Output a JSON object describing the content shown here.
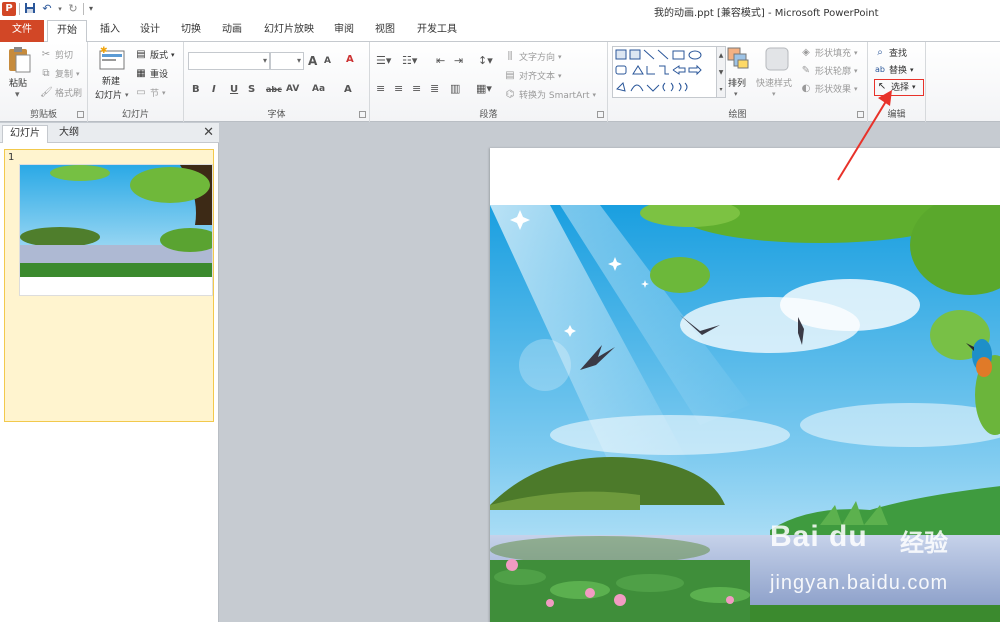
{
  "window": {
    "title": "我的动画.ppt [兼容模式] - Microsoft PowerPoint"
  },
  "qat": {
    "app_icon": "P"
  },
  "tabs": [
    {
      "label": "文件"
    },
    {
      "label": "开始"
    },
    {
      "label": "插入"
    },
    {
      "label": "设计"
    },
    {
      "label": "切换"
    },
    {
      "label": "动画"
    },
    {
      "label": "幻灯片放映"
    },
    {
      "label": "审阅"
    },
    {
      "label": "视图"
    },
    {
      "label": "开发工具"
    }
  ],
  "ribbon": {
    "clipboard": {
      "label": "剪贴板",
      "paste": "粘贴",
      "cut": "剪切",
      "copy": "复制",
      "format_painter": "格式刷"
    },
    "slides": {
      "label": "幻灯片",
      "new_slide_1": "新建",
      "new_slide_2": "幻灯片",
      "layout": "版式",
      "reset": "重设",
      "section": "节"
    },
    "font": {
      "label": "字体",
      "bold": "B",
      "italic": "I",
      "underline": "U",
      "shadow": "S",
      "strike": "abc",
      "spacing": "AV",
      "case": "Aa",
      "grow": "A",
      "shrink": "A",
      "clear": "A"
    },
    "paragraph": {
      "label": "段落",
      "text_direction": "文字方向",
      "align_text": "对齐文本",
      "convert_smartart": "转换为 SmartArt"
    },
    "drawing": {
      "label": "绘图",
      "arrange": "排列",
      "quick_styles": "快速样式",
      "shape_fill": "形状填充",
      "shape_outline": "形状轮廓",
      "shape_effects": "形状效果"
    },
    "editing": {
      "label": "编辑",
      "find": "查找",
      "replace": "替换",
      "select": "选择"
    }
  },
  "left_pane": {
    "tabs": [
      {
        "label": "幻灯片"
      },
      {
        "label": "大纲"
      }
    ],
    "close": "✕",
    "slides": [
      {
        "number": "1"
      }
    ]
  },
  "watermark": {
    "logo": "Bai du",
    "logo_cn": "经验",
    "url": "jingyan.baidu.com"
  }
}
